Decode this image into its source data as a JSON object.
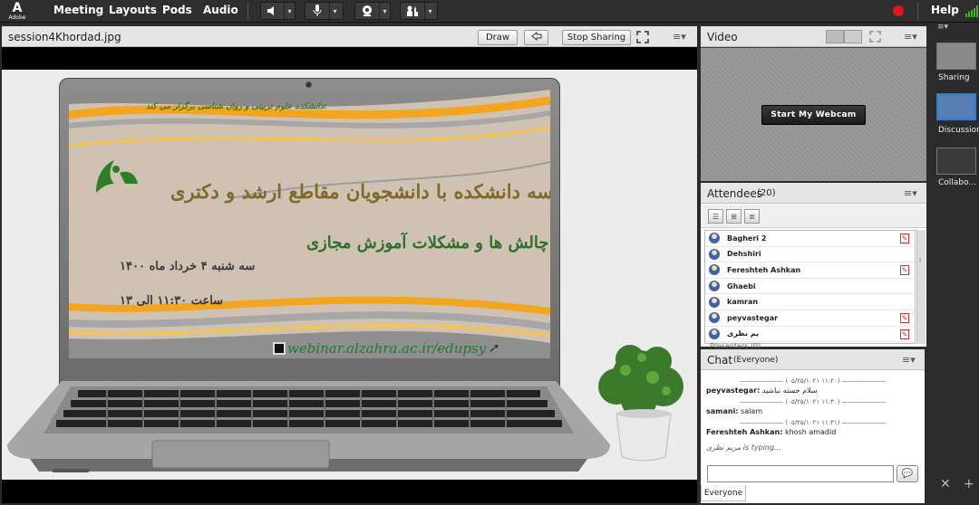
{
  "brand": {
    "logo_text": "Adobe"
  },
  "menu": {
    "meeting": "Meeting",
    "layouts": "Layouts",
    "pods": "Pods",
    "audio": "Audio",
    "help": "Help"
  },
  "share_pod": {
    "title": "session4Khordad.jpg",
    "draw": "Draw",
    "stop_sharing": "Stop Sharing"
  },
  "slide": {
    "slogan": "دانشکده علوم تربیتی و روان شناسی برگزار می کند:",
    "heading": "نشست هیات رئیسه دانشکده با دانشجویان مقاطع ارشد و دکتری",
    "subheading": "بررسی چالش ها و مشکلات آموزش مجازی",
    "date": "سه شنبه ۴ خرداد ماه ۱۴۰۰",
    "time": "ساعت ۱۱:۳۰ الی ۱۳",
    "url": "webinar.alzahra.ac.ir/edupsy"
  },
  "video_pod": {
    "title": "Video",
    "start_webcam": "Start My Webcam"
  },
  "attendees_pod": {
    "title": "Attendees",
    "count": "(20)",
    "presenters_label": "Presenters (0)",
    "attendees": [
      {
        "name": "Bagheri 2"
      },
      {
        "name": "Dehshiri"
      },
      {
        "name": "Fereshteh Ashkan"
      },
      {
        "name": "Ghaebi"
      },
      {
        "name": "kamran"
      },
      {
        "name": "peyvastegar"
      },
      {
        "name": "یم نظری"
      }
    ]
  },
  "chat_pod": {
    "title": "Chat",
    "scope": "(Everyone)",
    "messages": [
      {
        "timestamp": "(۰۵/۲۵/۱۰۲۱ ۱۱:۲۰)",
        "sender": "peyvastegar:",
        "text": "سلام خسته نباشید"
      },
      {
        "timestamp": "(۰۵/۲۵/۱۰۲۱ ۱۱:۳۰)",
        "sender": "samani:",
        "text": "salam"
      },
      {
        "timestamp": "(۰۵/۲۵/۱۰۲۱ ۱۱:۳۱)",
        "sender": "Fereshteh Ashkan:",
        "text": "khosh amadid"
      }
    ],
    "typing": "مریم نظری is typing...",
    "tab": "Everyone"
  },
  "layouts_panel": {
    "items": [
      {
        "label": "Sharing"
      },
      {
        "label": "Discussion"
      },
      {
        "label": "Collabo..."
      }
    ]
  },
  "colors": {
    "record": "#e0161e",
    "selected_layout": "#2a7fd4"
  },
  "icons": [
    "adobe-logo-icon",
    "speaker-icon",
    "microphone-icon",
    "webcam-icon",
    "raise-hand-icon",
    "record-icon",
    "signal-icon",
    "pointer-icon",
    "fullscreen-icon",
    "menu-icon",
    "grid-view-icon",
    "filmstrip-view-icon",
    "person-icon",
    "status-flag-icon",
    "send-chat-icon",
    "close-icon",
    "add-icon"
  ]
}
